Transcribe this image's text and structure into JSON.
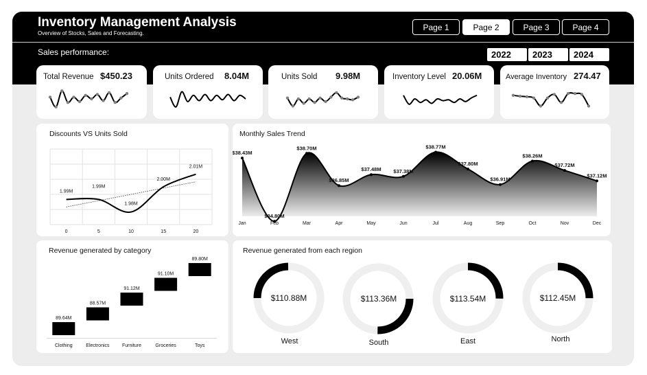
{
  "header": {
    "title": "Inventory Management Analysis",
    "subtitle": "Overview of Stocks, Sales and Forecasting.",
    "section_label": "Sales performance:",
    "pages": [
      "Page 1",
      "Page 2",
      "Page 3",
      "Page 4"
    ],
    "active_page": "Page 2",
    "years": [
      "2022",
      "2023",
      "2024"
    ]
  },
  "kpis": [
    {
      "label": "Total Revenue",
      "value": "$450.23",
      "spark": [
        0.6,
        0.05,
        0.95,
        0.3,
        0.6,
        0.35,
        0.7,
        0.5,
        0.75,
        0.4,
        0.85,
        0.3,
        0.55,
        0.8
      ],
      "markers": true
    },
    {
      "label": "Units Ordered",
      "value": "8.04M",
      "spark": [
        0.6,
        0.05,
        0.9,
        0.35,
        0.7,
        0.4,
        0.75,
        0.4,
        0.7,
        0.45,
        0.75,
        0.4,
        0.7,
        0.5
      ],
      "markers": false
    },
    {
      "label": "Units Sold",
      "value": "9.98M",
      "spark": [
        0.55,
        0.1,
        0.5,
        0.25,
        0.5,
        0.3,
        0.55,
        0.35,
        0.6,
        0.85,
        0.55,
        0.5,
        0.45,
        0.6
      ],
      "markers": true
    },
    {
      "label": "Inventory Level",
      "value": "20.06M",
      "spark": [
        0.7,
        0.2,
        0.5,
        0.3,
        0.45,
        0.25,
        0.5,
        0.4,
        0.45,
        0.3,
        0.5,
        0.35,
        0.55,
        0.7
      ],
      "markers": false
    },
    {
      "label": "Average Inventory",
      "value": "274.47",
      "spark": [
        0.7,
        0.65,
        0.62,
        0.55,
        0.1,
        0.55,
        0.75,
        0.3,
        0.8,
        0.8,
        0.75,
        0.1
      ],
      "markers": true
    }
  ],
  "discounts_chart": {
    "title": "Discounts VS Units Sold",
    "chart_data": {
      "type": "line",
      "x": [
        0,
        5,
        10,
        15,
        20
      ],
      "y_smooth": [
        1.99,
        1.99,
        1.98,
        2.0,
        2.01
      ],
      "labels": [
        "1.99M",
        "1.99M",
        "1.98M",
        "2.00M",
        "2.01M"
      ],
      "xlim": [
        -2.5,
        22.5
      ],
      "trendline": true
    }
  },
  "monthly_chart": {
    "title": "Monthly Sales Trend",
    "chart_data": {
      "type": "area",
      "categories": [
        "Jan",
        "Feb",
        "Mar",
        "Apr",
        "May",
        "Jun",
        "Jul",
        "Aug",
        "Sep",
        "Oct",
        "Nov",
        "Dec"
      ],
      "values": [
        38.43,
        34.8,
        38.7,
        36.85,
        37.48,
        37.38,
        38.77,
        37.8,
        36.91,
        38.26,
        37.72,
        37.12
      ],
      "labels": [
        "$38.43M",
        "$34.80M",
        "$38.70M",
        "$36.85M",
        "$37.48M",
        "$37.38M",
        "$38.77M",
        "$37.80M",
        "$36.91M",
        "$38.26M",
        "$37.72M",
        "$37.12M"
      ],
      "ylim": [
        34,
        39.5
      ]
    }
  },
  "category_chart": {
    "title": "Revenue generated by category",
    "chart_data": {
      "type": "bar",
      "categories": [
        "Clothing",
        "Electronics",
        "Furniture",
        "Groceries",
        "Toys"
      ],
      "values": [
        89.64,
        88.57,
        91.12,
        91.1,
        89.8
      ],
      "labels": [
        "89.64M",
        "88.57M",
        "91.12M",
        "91.10M",
        "89.80M"
      ]
    }
  },
  "region_chart": {
    "title": "Revenue generated from each region",
    "chart_data": {
      "type": "pie",
      "regions": [
        {
          "name": "West",
          "value": "$110.88M",
          "share": 0.246
        },
        {
          "name": "South",
          "value": "$113.36M",
          "share": 0.252
        },
        {
          "name": "East",
          "value": "$113.54M",
          "share": 0.252
        },
        {
          "name": "North",
          "value": "$112.45M",
          "share": 0.25
        }
      ]
    }
  },
  "colors": {
    "dark": "#000000",
    "panel": "#ffffff",
    "background": "#ededed",
    "ring_track": "#efefef",
    "marker": "#808080"
  }
}
